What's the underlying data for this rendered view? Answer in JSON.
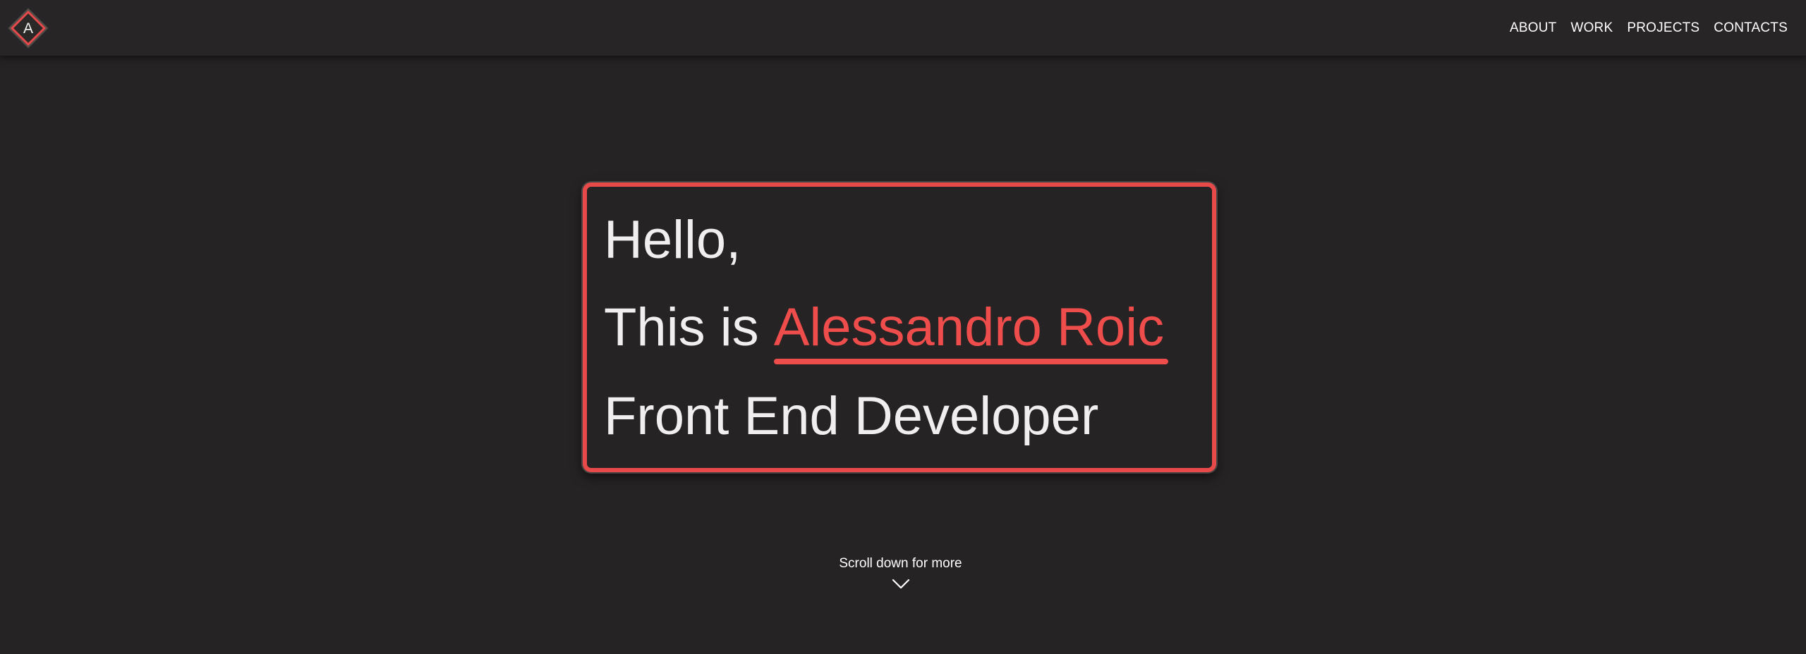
{
  "navbar": {
    "logo_letter": "A",
    "links": [
      {
        "label": "ABOUT"
      },
      {
        "label": "WORK"
      },
      {
        "label": "PROJECTS"
      },
      {
        "label": "CONTACTS"
      }
    ]
  },
  "hero": {
    "greeting": "Hello,",
    "intro_prefix": "This is ",
    "name": "Alessandro Roic",
    "role": "Front End Developer"
  },
  "scroll": {
    "text": "Scroll down for more",
    "icon": "chevron-down-icon"
  },
  "colors": {
    "background": "#252323",
    "navbar": "#272525",
    "accent": "#ef4c4c",
    "text": "#f0eeee"
  }
}
